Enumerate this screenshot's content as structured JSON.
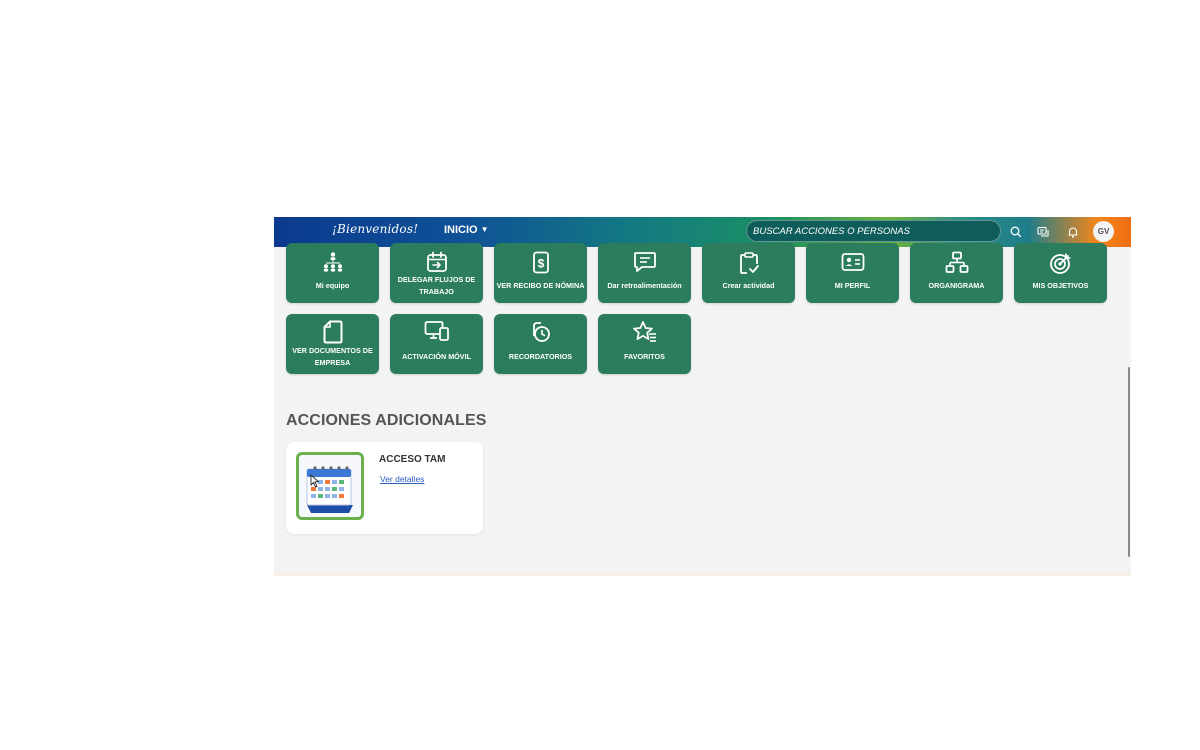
{
  "header": {
    "brand": "¡Bienvenidos!",
    "nav_label": "INICIO",
    "search_placeholder": "BUSCAR ACCIONES O PERSONAS",
    "avatar_initials": "GV"
  },
  "tiles": [
    {
      "label": "Mi equipo",
      "icon": "team-icon"
    },
    {
      "label": "DELEGAR FLUJOS DE TRABAJO",
      "icon": "delegate-calendar-icon"
    },
    {
      "label": "VER RECIBO DE NÓMINA",
      "icon": "payroll-receipt-icon"
    },
    {
      "label": "Dar retroalimentación",
      "icon": "feedback-icon"
    },
    {
      "label": "Crear actividad",
      "icon": "clipboard-check-icon"
    },
    {
      "label": "MI PERFIL",
      "icon": "profile-card-icon"
    },
    {
      "label": "ORGANIGRAMA",
      "icon": "org-chart-icon"
    },
    {
      "label": "MIS OBJETIVOS",
      "icon": "target-icon"
    },
    {
      "label": "VER DOCUMENTOS DE EMPRESA",
      "icon": "document-icon"
    },
    {
      "label": "ACTIVACIÓN MÓVIL",
      "icon": "devices-icon"
    },
    {
      "label": "RECORDATORIOS",
      "icon": "reminder-icon"
    },
    {
      "label": "FAVORITOS",
      "icon": "favorites-icon"
    }
  ],
  "section": {
    "title": "ACCIONES ADICIONALES"
  },
  "card": {
    "title": "ACCESO TAM",
    "link": "Ver detalles",
    "icon": "calendar-icon"
  },
  "colors": {
    "tile_green": "#2b7d5d",
    "thumb_border": "#6ab04c",
    "link_blue": "#2a5fc1"
  }
}
